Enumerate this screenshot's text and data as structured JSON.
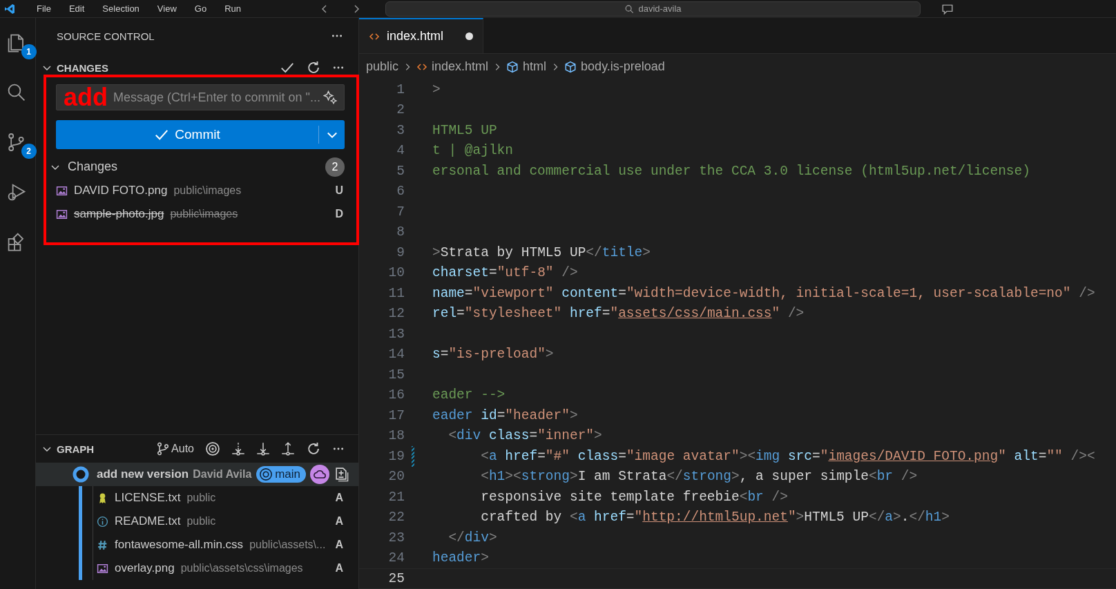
{
  "title_bar": {
    "menu": [
      "File",
      "Edit",
      "Selection",
      "View",
      "Go",
      "Run"
    ],
    "search": "david-avila"
  },
  "activity_bar": [
    {
      "kind": "explorer",
      "badge": "1"
    },
    {
      "kind": "search"
    },
    {
      "kind": "source_control",
      "badge": "2"
    },
    {
      "kind": "run"
    },
    {
      "kind": "extensions"
    }
  ],
  "sidebar": {
    "title": "SOURCE CONTROL",
    "changes": {
      "title": "CHANGES",
      "expanded": true,
      "message_placeholder": "Message (Ctrl+Enter to commit on \"...",
      "commit_button": "Commit",
      "group": {
        "label": "Changes",
        "count": "2",
        "expanded": true,
        "files": [
          {
            "name": "DAVID FOTO.png",
            "path": "public\\images",
            "status": "U",
            "deleted": false,
            "kind": "image"
          },
          {
            "name": "sample-photo.jpg",
            "path": "public\\images",
            "status": "D",
            "deleted": true,
            "kind": "image"
          }
        ]
      }
    },
    "graph": {
      "title": "GRAPH",
      "expanded": true,
      "mode": "Auto",
      "commit": {
        "message": "add new version",
        "author": "David Avila",
        "branch": "main"
      },
      "files": [
        {
          "name": "LICENSE.txt",
          "path": "public",
          "status": "A",
          "kind": "license"
        },
        {
          "name": "README.txt",
          "path": "public",
          "status": "A",
          "kind": "info"
        },
        {
          "name": "fontawesome-all.min.css",
          "path": "public\\assets\\...",
          "status": "A",
          "kind": "css"
        },
        {
          "name": "overlay.png",
          "path": "public\\assets\\css\\images",
          "status": "A",
          "kind": "image"
        }
      ]
    }
  },
  "editor": {
    "tabs": [
      {
        "label": "index.html",
        "selected": true,
        "dirty": true
      }
    ],
    "breadcrumbs": [
      {
        "label": "public",
        "kind": "folder"
      },
      {
        "label": "index.html",
        "kind": "html"
      },
      {
        "label": "html",
        "kind": "element"
      },
      {
        "label": "body.is-preload",
        "kind": "element"
      }
    ],
    "lines": [
      {
        "number": "1",
        "modified": false,
        "current": false,
        "tokens": [
          {
            "kind": "p",
            "t": ">"
          }
        ]
      },
      {
        "number": "2",
        "modified": false,
        "current": false
      },
      {
        "number": "3",
        "modified": false,
        "current": false,
        "tokens": [
          {
            "kind": "c",
            "t": "HTML5 UP"
          }
        ]
      },
      {
        "number": "4",
        "modified": false,
        "current": false,
        "tokens": [
          {
            "kind": "c",
            "t": "t | @ajlkn"
          }
        ]
      },
      {
        "number": "5",
        "modified": false,
        "current": false,
        "tokens": [
          {
            "kind": "c",
            "t": "ersonal and commercial use under the CCA 3.0 license (html5up.net/license)"
          }
        ]
      },
      {
        "number": "6",
        "modified": false,
        "current": false
      },
      {
        "number": "7",
        "modified": false,
        "current": false
      },
      {
        "number": "8",
        "modified": false,
        "current": false
      },
      {
        "number": "9",
        "modified": false,
        "current": false,
        "tokens": [
          {
            "kind": "p",
            "t": ">"
          },
          {
            "kind": "x",
            "t": "Strata by HTML5 UP"
          },
          {
            "kind": "p",
            "t": "</"
          },
          {
            "kind": "t",
            "t": "title"
          },
          {
            "kind": "p",
            "t": ">"
          }
        ]
      },
      {
        "number": "10",
        "modified": false,
        "current": false,
        "tokens": [
          {
            "kind": "a",
            "t": "charset"
          },
          {
            "kind": "x",
            "t": "="
          },
          {
            "kind": "s",
            "t": "\"utf-8\""
          },
          {
            "kind": "p",
            "t": " />"
          }
        ]
      },
      {
        "number": "11",
        "modified": false,
        "current": false,
        "tokens": [
          {
            "kind": "a",
            "t": "name"
          },
          {
            "kind": "x",
            "t": "="
          },
          {
            "kind": "s",
            "t": "\"viewport\""
          },
          {
            "kind": "a",
            "t": " content"
          },
          {
            "kind": "x",
            "t": "="
          },
          {
            "kind": "s",
            "t": "\"width=device-width, initial-scale=1, user-scalable=no\""
          },
          {
            "kind": "p",
            "t": " />"
          }
        ]
      },
      {
        "number": "12",
        "modified": false,
        "current": false,
        "tokens": [
          {
            "kind": "a",
            "t": "rel"
          },
          {
            "kind": "x",
            "t": "="
          },
          {
            "kind": "s",
            "t": "\"stylesheet\""
          },
          {
            "kind": "a",
            "t": " href"
          },
          {
            "kind": "x",
            "t": "="
          },
          {
            "kind": "s",
            "t": "\""
          },
          {
            "kind": "u",
            "t": "assets/css/main.css"
          },
          {
            "kind": "s",
            "t": "\""
          },
          {
            "kind": "p",
            "t": " />"
          }
        ]
      },
      {
        "number": "13",
        "modified": false,
        "current": false
      },
      {
        "number": "14",
        "modified": false,
        "current": false,
        "tokens": [
          {
            "kind": "a",
            "t": "s"
          },
          {
            "kind": "x",
            "t": "="
          },
          {
            "kind": "s",
            "t": "\"is-preload\""
          },
          {
            "kind": "p",
            "t": ">"
          }
        ]
      },
      {
        "number": "15",
        "modified": false,
        "current": false
      },
      {
        "number": "16",
        "modified": false,
        "current": false,
        "tokens": [
          {
            "kind": "c",
            "t": "eader -->"
          }
        ]
      },
      {
        "number": "17",
        "modified": false,
        "current": false,
        "tokens": [
          {
            "kind": "t",
            "t": "eader"
          },
          {
            "kind": "a",
            "t": " id"
          },
          {
            "kind": "x",
            "t": "="
          },
          {
            "kind": "s",
            "t": "\"header\""
          },
          {
            "kind": "p",
            "t": ">"
          }
        ]
      },
      {
        "number": "18",
        "modified": false,
        "current": false,
        "tokens": [
          {
            "kind": "p",
            "t": "  <"
          },
          {
            "kind": "t",
            "t": "div"
          },
          {
            "kind": "a",
            "t": " class"
          },
          {
            "kind": "x",
            "t": "="
          },
          {
            "kind": "s",
            "t": "\"inner\""
          },
          {
            "kind": "p",
            "t": ">"
          }
        ]
      },
      {
        "number": "19",
        "modified": true,
        "current": false,
        "tokens": [
          {
            "kind": "p",
            "t": "      <"
          },
          {
            "kind": "t",
            "t": "a"
          },
          {
            "kind": "a",
            "t": " href"
          },
          {
            "kind": "x",
            "t": "="
          },
          {
            "kind": "s",
            "t": "\"#\""
          },
          {
            "kind": "a",
            "t": " class"
          },
          {
            "kind": "x",
            "t": "="
          },
          {
            "kind": "s",
            "t": "\"image avatar\""
          },
          {
            "kind": "p",
            "t": "><"
          },
          {
            "kind": "t",
            "t": "img"
          },
          {
            "kind": "a",
            "t": " src"
          },
          {
            "kind": "x",
            "t": "="
          },
          {
            "kind": "s",
            "t": "\""
          },
          {
            "kind": "u",
            "t": "images/DAVID FOTO.png"
          },
          {
            "kind": "s",
            "t": "\""
          },
          {
            "kind": "a",
            "t": " alt"
          },
          {
            "kind": "x",
            "t": "="
          },
          {
            "kind": "s",
            "t": "\"\""
          },
          {
            "kind": "p",
            "t": " /><"
          }
        ]
      },
      {
        "number": "20",
        "modified": false,
        "current": false,
        "tokens": [
          {
            "kind": "p",
            "t": "      <"
          },
          {
            "kind": "t",
            "t": "h1"
          },
          {
            "kind": "p",
            "t": "><"
          },
          {
            "kind": "t",
            "t": "strong"
          },
          {
            "kind": "p",
            "t": ">"
          },
          {
            "kind": "x",
            "t": "I am Strata"
          },
          {
            "kind": "p",
            "t": "</"
          },
          {
            "kind": "t",
            "t": "strong"
          },
          {
            "kind": "p",
            "t": ">"
          },
          {
            "kind": "x",
            "t": ", a super simple"
          },
          {
            "kind": "p",
            "t": "<"
          },
          {
            "kind": "t",
            "t": "br"
          },
          {
            "kind": "p",
            "t": " />"
          }
        ]
      },
      {
        "number": "21",
        "modified": false,
        "current": false,
        "tokens": [
          {
            "kind": "x",
            "t": "      responsive site template freebie"
          },
          {
            "kind": "p",
            "t": "<"
          },
          {
            "kind": "t",
            "t": "br"
          },
          {
            "kind": "p",
            "t": " />"
          }
        ]
      },
      {
        "number": "22",
        "modified": false,
        "current": false,
        "tokens": [
          {
            "kind": "x",
            "t": "      crafted by "
          },
          {
            "kind": "p",
            "t": "<"
          },
          {
            "kind": "t",
            "t": "a"
          },
          {
            "kind": "a",
            "t": " href"
          },
          {
            "kind": "x",
            "t": "="
          },
          {
            "kind": "s",
            "t": "\""
          },
          {
            "kind": "u",
            "t": "http://html5up.net"
          },
          {
            "kind": "s",
            "t": "\""
          },
          {
            "kind": "p",
            "t": ">"
          },
          {
            "kind": "x",
            "t": "HTML5 UP"
          },
          {
            "kind": "p",
            "t": "</"
          },
          {
            "kind": "t",
            "t": "a"
          },
          {
            "kind": "p",
            "t": ">"
          },
          {
            "kind": "x",
            "t": "."
          },
          {
            "kind": "p",
            "t": "</"
          },
          {
            "kind": "t",
            "t": "h1"
          },
          {
            "kind": "p",
            "t": ">"
          }
        ]
      },
      {
        "number": "23",
        "modified": false,
        "current": false,
        "tokens": [
          {
            "kind": "p",
            "t": "  </"
          },
          {
            "kind": "t",
            "t": "div"
          },
          {
            "kind": "p",
            "t": ">"
          }
        ]
      },
      {
        "number": "24",
        "modified": false,
        "current": false,
        "tokens": [
          {
            "kind": "t",
            "t": "header"
          },
          {
            "kind": "p",
            "t": ">"
          }
        ]
      },
      {
        "number": "25",
        "modified": false,
        "current": true
      }
    ]
  },
  "annotation": {
    "text": "add"
  }
}
